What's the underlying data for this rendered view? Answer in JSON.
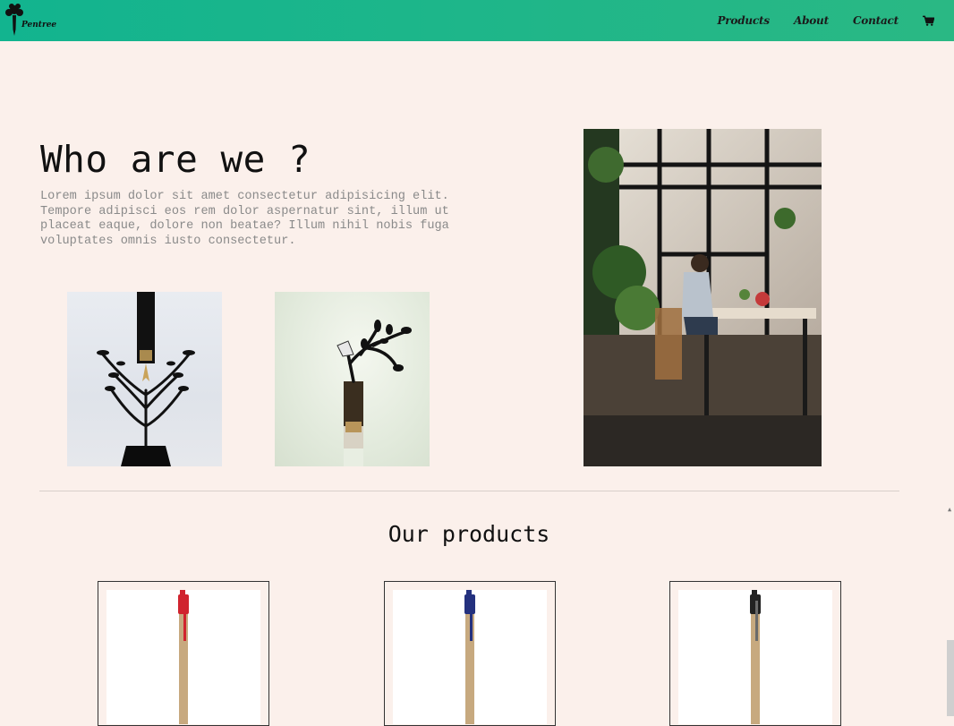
{
  "nav": {
    "logo_text": "Pentree",
    "links": [
      "Products",
      "About",
      "Contact"
    ]
  },
  "hero": {
    "title": "Who are we ?",
    "text": "Lorem ipsum dolor sit amet consectetur adipisicing elit. Tempore adipisci eos rem dolor aspernatur sint, illum ut placeat eaque, dolore non beatae? Illum nihil nobis fuga voluptates omnis iusto consectetur."
  },
  "products": {
    "title": "Our products",
    "items": [
      {
        "clip_color": "#d0242f"
      },
      {
        "clip_color": "#24317e"
      },
      {
        "clip_color": "#222222"
      }
    ]
  },
  "colors": {
    "navbar": "#12b48f",
    "background": "#fbf0eb",
    "pen_body": "#c7a97f"
  }
}
